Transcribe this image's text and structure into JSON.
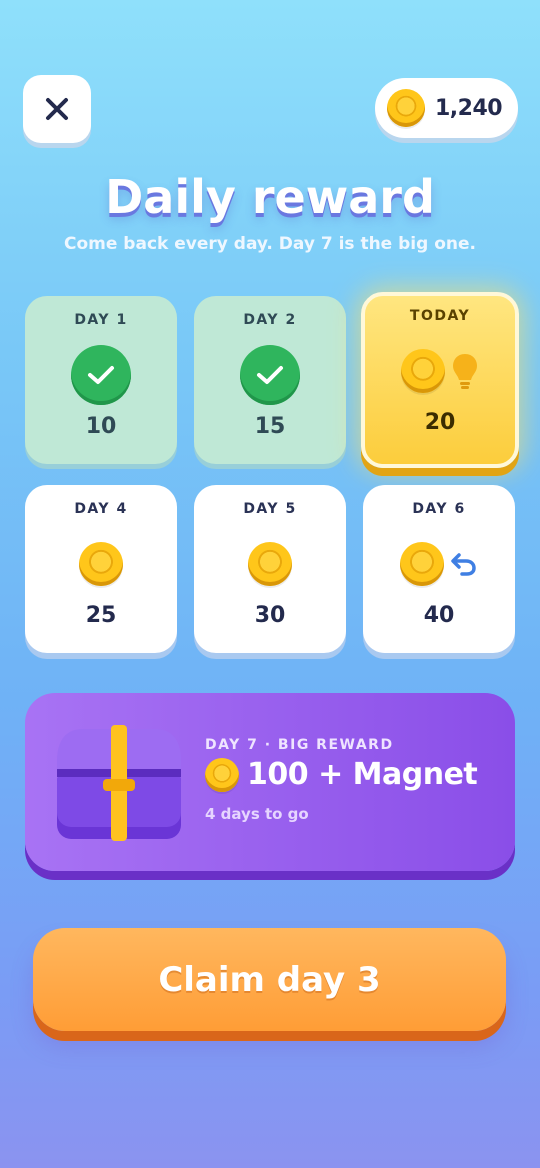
{
  "header": {
    "close_icon": "close-icon",
    "coin_balance": "1,240"
  },
  "title": "Daily reward",
  "subtitle": "Come back every day. Day 7 is the big one.",
  "days": [
    {
      "label": "DAY 1",
      "amount": "10",
      "state": "claimed"
    },
    {
      "label": "DAY 2",
      "amount": "15",
      "state": "claimed"
    },
    {
      "label": "TODAY",
      "amount": "20",
      "state": "today",
      "bonus_icon": "lightbulb-icon"
    },
    {
      "label": "DAY 4",
      "amount": "25",
      "state": "locked"
    },
    {
      "label": "DAY 5",
      "amount": "30",
      "state": "locked"
    },
    {
      "label": "DAY 6",
      "amount": "40",
      "state": "locked",
      "bonus_icon": "undo-icon"
    }
  ],
  "big_reward": {
    "tag": "DAY 7 · BIG REWARD",
    "prize": "100 + Magnet",
    "countdown": "4 days to go"
  },
  "claim_button": "Claim day 3",
  "colors": {
    "claimed": "#bfe8d6",
    "today": "#fccd3c",
    "big_reward": "#8a4ee8",
    "claim": "#ff9d36",
    "check": "#2fb55d"
  }
}
